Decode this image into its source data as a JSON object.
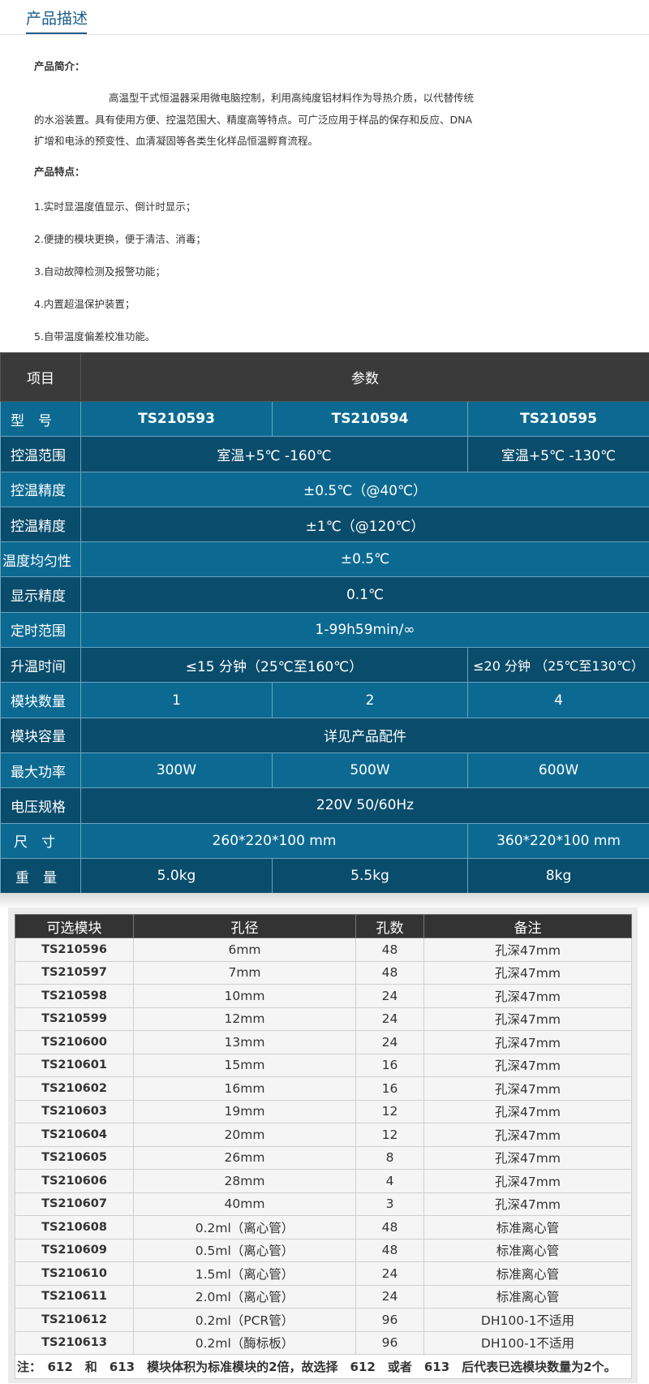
{
  "section": {
    "title": "产品描述"
  },
  "intro": {
    "heading": "产品简介：",
    "line1": "高温型干式恒温器采用微电脑控制，利用高纯度铝材料作为导热介质，以代替传统",
    "line2": "的水浴装置。具有使用方便、控温范围大、精度高等特点。可广泛应用于样品的保存和反应、DNA",
    "line3": "扩增和电泳的预变性、血清凝固等各类生化样品恒温孵育流程。",
    "features_heading": "产品特点：",
    "features": [
      "1.实时显温度值显示、倒计时显示；",
      "2.便捷的模块更换，便于清洁、消毒；",
      "3.自动故障检测及报警功能；",
      "4.内置超温保护装置；",
      "5.自带温度偏差校准功能。"
    ]
  },
  "spec": {
    "head": {
      "item": "项目",
      "param": "参数"
    },
    "model": {
      "label": "型　号",
      "m1": "TS210593",
      "m2": "TS210594",
      "m3": "TS210595"
    },
    "range": {
      "label": "控温范围",
      "v12": "室温+5℃ -160℃",
      "v3": "室温+5℃ -130℃"
    },
    "acc1": {
      "label": "控温精度",
      "v": "±0.5℃（@40℃）"
    },
    "acc2": {
      "label": "控温精度",
      "v": "±1℃（@120℃）"
    },
    "uniform": {
      "label": "温度均匀性",
      "v": "±0.5℃"
    },
    "display": {
      "label": "显示精度",
      "v": "0.1℃"
    },
    "timer": {
      "label": "定时范围",
      "v": "1-99h59min/∞"
    },
    "heat": {
      "label": "升温时间",
      "v12": "≤15 分钟（25℃至160℃）",
      "v3": "≤20 分钟 （25℃至130℃）"
    },
    "modules": {
      "label": "模块数量",
      "m1": "1",
      "m2": "2",
      "m3": "4"
    },
    "capacity": {
      "label": "模块容量",
      "v": "详见产品配件"
    },
    "power": {
      "label": "最大功率",
      "m1": "300W",
      "m2": "500W",
      "m3": "600W"
    },
    "voltage": {
      "label": "电压规格",
      "v": "220V 50/60Hz"
    },
    "size": {
      "label": "尺　寸",
      "v12": "260*220*100 mm",
      "v3": "360*220*100 mm"
    },
    "weight": {
      "label": "重　量",
      "m1": "5.0kg",
      "m2": "5.5kg",
      "m3": "8kg"
    }
  },
  "modules": {
    "headers": [
      "可选模块",
      "孔径",
      "孔数",
      "备注"
    ],
    "rows": [
      [
        "TS210596",
        "6mm",
        "48",
        "孔深47mm"
      ],
      [
        "TS210597",
        "7mm",
        "48",
        "孔深47mm"
      ],
      [
        "TS210598",
        "10mm",
        "24",
        "孔深47mm"
      ],
      [
        "TS210599",
        "12mm",
        "24",
        "孔深47mm"
      ],
      [
        "TS210600",
        "13mm",
        "24",
        "孔深47mm"
      ],
      [
        "TS210601",
        "15mm",
        "16",
        "孔深47mm"
      ],
      [
        "TS210602",
        "16mm",
        "16",
        "孔深47mm"
      ],
      [
        "TS210603",
        "19mm",
        "12",
        "孔深47mm"
      ],
      [
        "TS210604",
        "20mm",
        "12",
        "孔深47mm"
      ],
      [
        "TS210605",
        "26mm",
        "8",
        "孔深47mm"
      ],
      [
        "TS210606",
        "28mm",
        "4",
        "孔深47mm"
      ],
      [
        "TS210607",
        "40mm",
        "3",
        "孔深47mm"
      ],
      [
        "TS210608",
        "0.2ml（离心管）",
        "48",
        "标准离心管"
      ],
      [
        "TS210609",
        "0.5ml（离心管）",
        "48",
        "标准离心管"
      ],
      [
        "TS210610",
        "1.5ml（离心管）",
        "24",
        "标准离心管"
      ],
      [
        "TS210611",
        "2.0ml（离心管）",
        "24",
        "标准离心管"
      ],
      [
        "TS210612",
        "0.2ml（PCR管）",
        "96",
        "DH100-1不适用"
      ],
      [
        "TS210613",
        "0.2ml（酶标板）",
        "96",
        "DH100-1不适用"
      ]
    ],
    "note": "注：　612　和　613　模块体积为标准模块的2倍，故选择　612　或者　613　后代表已选模块数量为2个。"
  }
}
